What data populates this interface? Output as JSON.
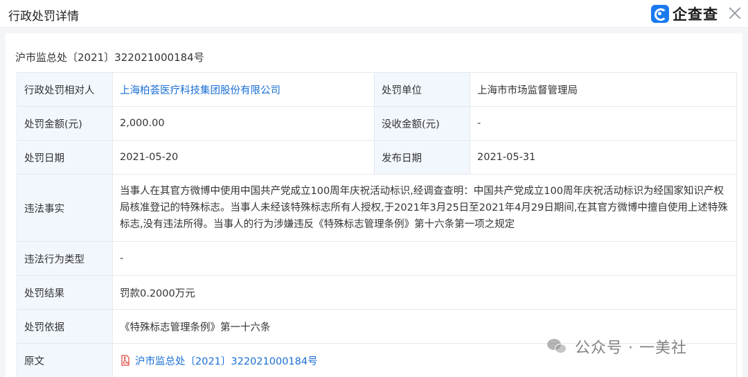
{
  "header": {
    "title": "行政处罚详情",
    "brand_name": "企查查",
    "brand_color": "#1a7bf0"
  },
  "case_number": "沪市监总处〔2021〕322021000184号",
  "table": {
    "party_label": "行政处罚相对人",
    "party_value": "上海柏荟医疗科技集团股份有限公司",
    "authority_label": "处罚单位",
    "authority_value": "上海市市场监督管理局",
    "fine_label": "处罚金额(元)",
    "fine_value": "2,000.00",
    "confiscation_label": "没收金额(元)",
    "confiscation_value": "-",
    "penalty_date_label": "处罚日期",
    "penalty_date_value": "2021-05-20",
    "publish_date_label": "发布日期",
    "publish_date_value": "2021-05-31",
    "facts_label": "违法事实",
    "facts_value": "当事人在其官方微博中使用中国共产党成立100周年庆祝活动标识,经调查查明：中国共产党成立100周年庆祝活动标识为经国家知识产权局核准登记的特殊标志。当事人未经该特殊标志所有人授权,于2021年3月25日至2021年4月29日期间,在其官方微博中擅自使用上述特殊标志,没有违法所得。当事人的行为涉嫌违反《特殊标志管理条例》第十六条第一项之规定",
    "violation_type_label": "违法行为类型",
    "violation_type_value": "-",
    "result_label": "处罚结果",
    "result_value": "罚款0.2000万元",
    "basis_label": "处罚依据",
    "basis_value": "《特殊标志管理条例》第一十六条",
    "original_label": "原文",
    "original_value": "沪市监总处〔2021〕322021000184号"
  },
  "watermark": {
    "text": "公众号 · 一美社"
  },
  "colors": {
    "link": "#1a6fd6",
    "label_bg": "#f2f7fe",
    "pdf_red": "#e0423a"
  }
}
